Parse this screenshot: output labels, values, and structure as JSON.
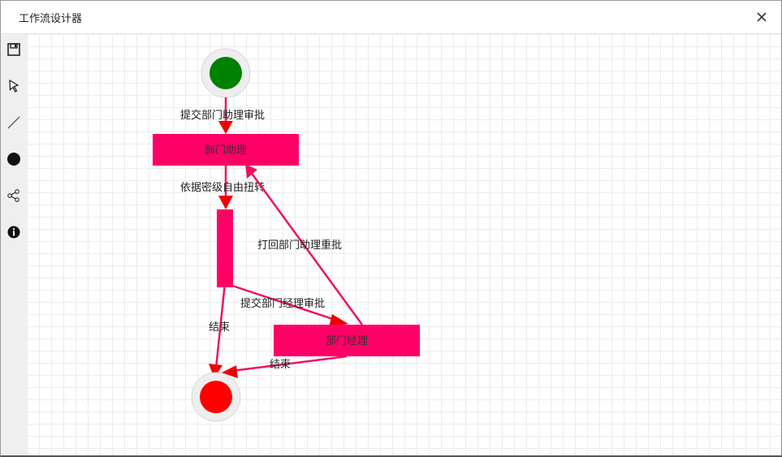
{
  "window": {
    "title": "工作流设计器",
    "close_icon": "close-icon"
  },
  "toolbar": {
    "items": [
      {
        "name": "save",
        "icon": "save-icon"
      },
      {
        "name": "select",
        "icon": "cursor-arrow-icon"
      },
      {
        "name": "line",
        "icon": "line-icon"
      },
      {
        "name": "node",
        "icon": "filled-circle-icon"
      },
      {
        "name": "fork",
        "icon": "fork-icon"
      },
      {
        "name": "info",
        "icon": "info-icon"
      }
    ]
  },
  "diagram": {
    "colors": {
      "start": "#008000",
      "end": "#ff0000",
      "task": "#ff0066",
      "edge": "#ee1166"
    },
    "nodes": {
      "task_assistant": "部门助理",
      "task_manager": "部门经理"
    },
    "edges": {
      "submit_assistant": "提交部门助理审批",
      "route_by_level": "依据密级自由扭转",
      "reject_back": "打回部门助理重批",
      "submit_manager": "提交部门经理审批",
      "end_from_gateway": "结束",
      "end_from_manager": "结束"
    }
  }
}
